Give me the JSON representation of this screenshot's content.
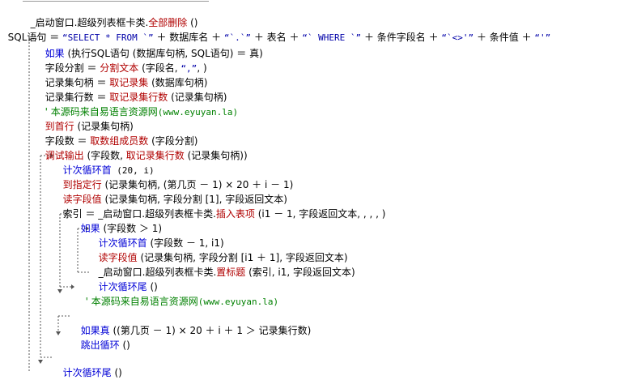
{
  "code": {
    "l1_a": "_启动窗口.超级列表框卡类.",
    "l1_b": "全部删除",
    "l1_c": " ()",
    "l2_a": "SQL语句 ＝ ",
    "l2_b": "“SELECT * FROM `”",
    "l2_c": " ＋ 数据库名 ＋ ",
    "l2_d": "“`.`”",
    "l2_e": " ＋ 表名 ＋ ",
    "l2_f": "“` WHERE `”",
    "l2_g": " ＋ 条件字段名 ＋ ",
    "l2_h": "“`<>'”",
    "l2_i": " ＋ 条件值 ＋ ",
    "l2_j": "“'”",
    "l3_a": "如果",
    "l3_b": " (执行SQL语句 (数据库句柄, SQL语句) ＝ 真)",
    "l4_a": "字段分割 ＝ ",
    "l4_b": "分割文本",
    "l4_c": " (字段名, ",
    "l4_d": "“,”",
    "l4_e": ", )",
    "l5_a": "记录集句柄 ＝ ",
    "l5_b": "取记录集",
    "l5_c": " (数据库句柄)",
    "l6_a": "记录集行数 ＝ ",
    "l6_b": "取记录集行数",
    "l6_c": " (记录集句柄)",
    "l7_a": "' 本源码来自易语言资源网",
    "l7_b": "(www.eyuyan.la)",
    "l8_a": "到首行",
    "l8_b": " (记录集句柄)",
    "l9_a": "字段数 ＝ ",
    "l9_b": "取数组成员数",
    "l9_c": " (字段分割)",
    "l10_a": "调试输出",
    "l10_b": " (字段数, ",
    "l10_c": "取记录集行数",
    "l10_d": " (记录集句柄))",
    "l11_a": "计次循环首",
    "l11_b": " (20, i)",
    "l12_a": "到指定行",
    "l12_b": " (记录集句柄, (第几页 － 1) × 20 ＋ i － 1)",
    "l13_a": "读字段值",
    "l13_b": " (记录集句柄, 字段分割 [1], 字段返回文本)",
    "l14_a": "索引 ＝ _启动窗口.超级列表框卡类.",
    "l14_b": "插入表项",
    "l14_c": " (i1 － 1, 字段返回文本, , , , )",
    "l15_a": "如果",
    "l15_b": " (字段数 ＞ 1)",
    "l16_a": "计次循环首",
    "l16_b": " (字段数 － 1, i1)",
    "l17_a": "读字段值",
    "l17_b": " (记录集句柄, 字段分割 [i1 ＋ 1], 字段返回文本)",
    "l18_a": "_启动窗口.超级列表框卡类.",
    "l18_b": "置标题",
    "l18_c": " (索引, i1, 字段返回文本)",
    "l19_a": "计次循环尾",
    "l19_b": " ()",
    "l20_a": "' 本源码来自易语言资源网",
    "l20_b": "(www.eyuyan.la)",
    "l21_a": "如果真",
    "l21_b": " ((第几页 － 1) × 20 ＋ i ＋ 1 ＞ 记录集行数)",
    "l22_a": "跳出循环",
    "l22_b": " ()",
    "l23_a": "计次循环尾",
    "l23_b": " ()"
  },
  "colors": {
    "function": "#b00000",
    "keyword": "#0000d6",
    "string": "#0000a8",
    "comment": "#008000",
    "guide": "#555555"
  }
}
